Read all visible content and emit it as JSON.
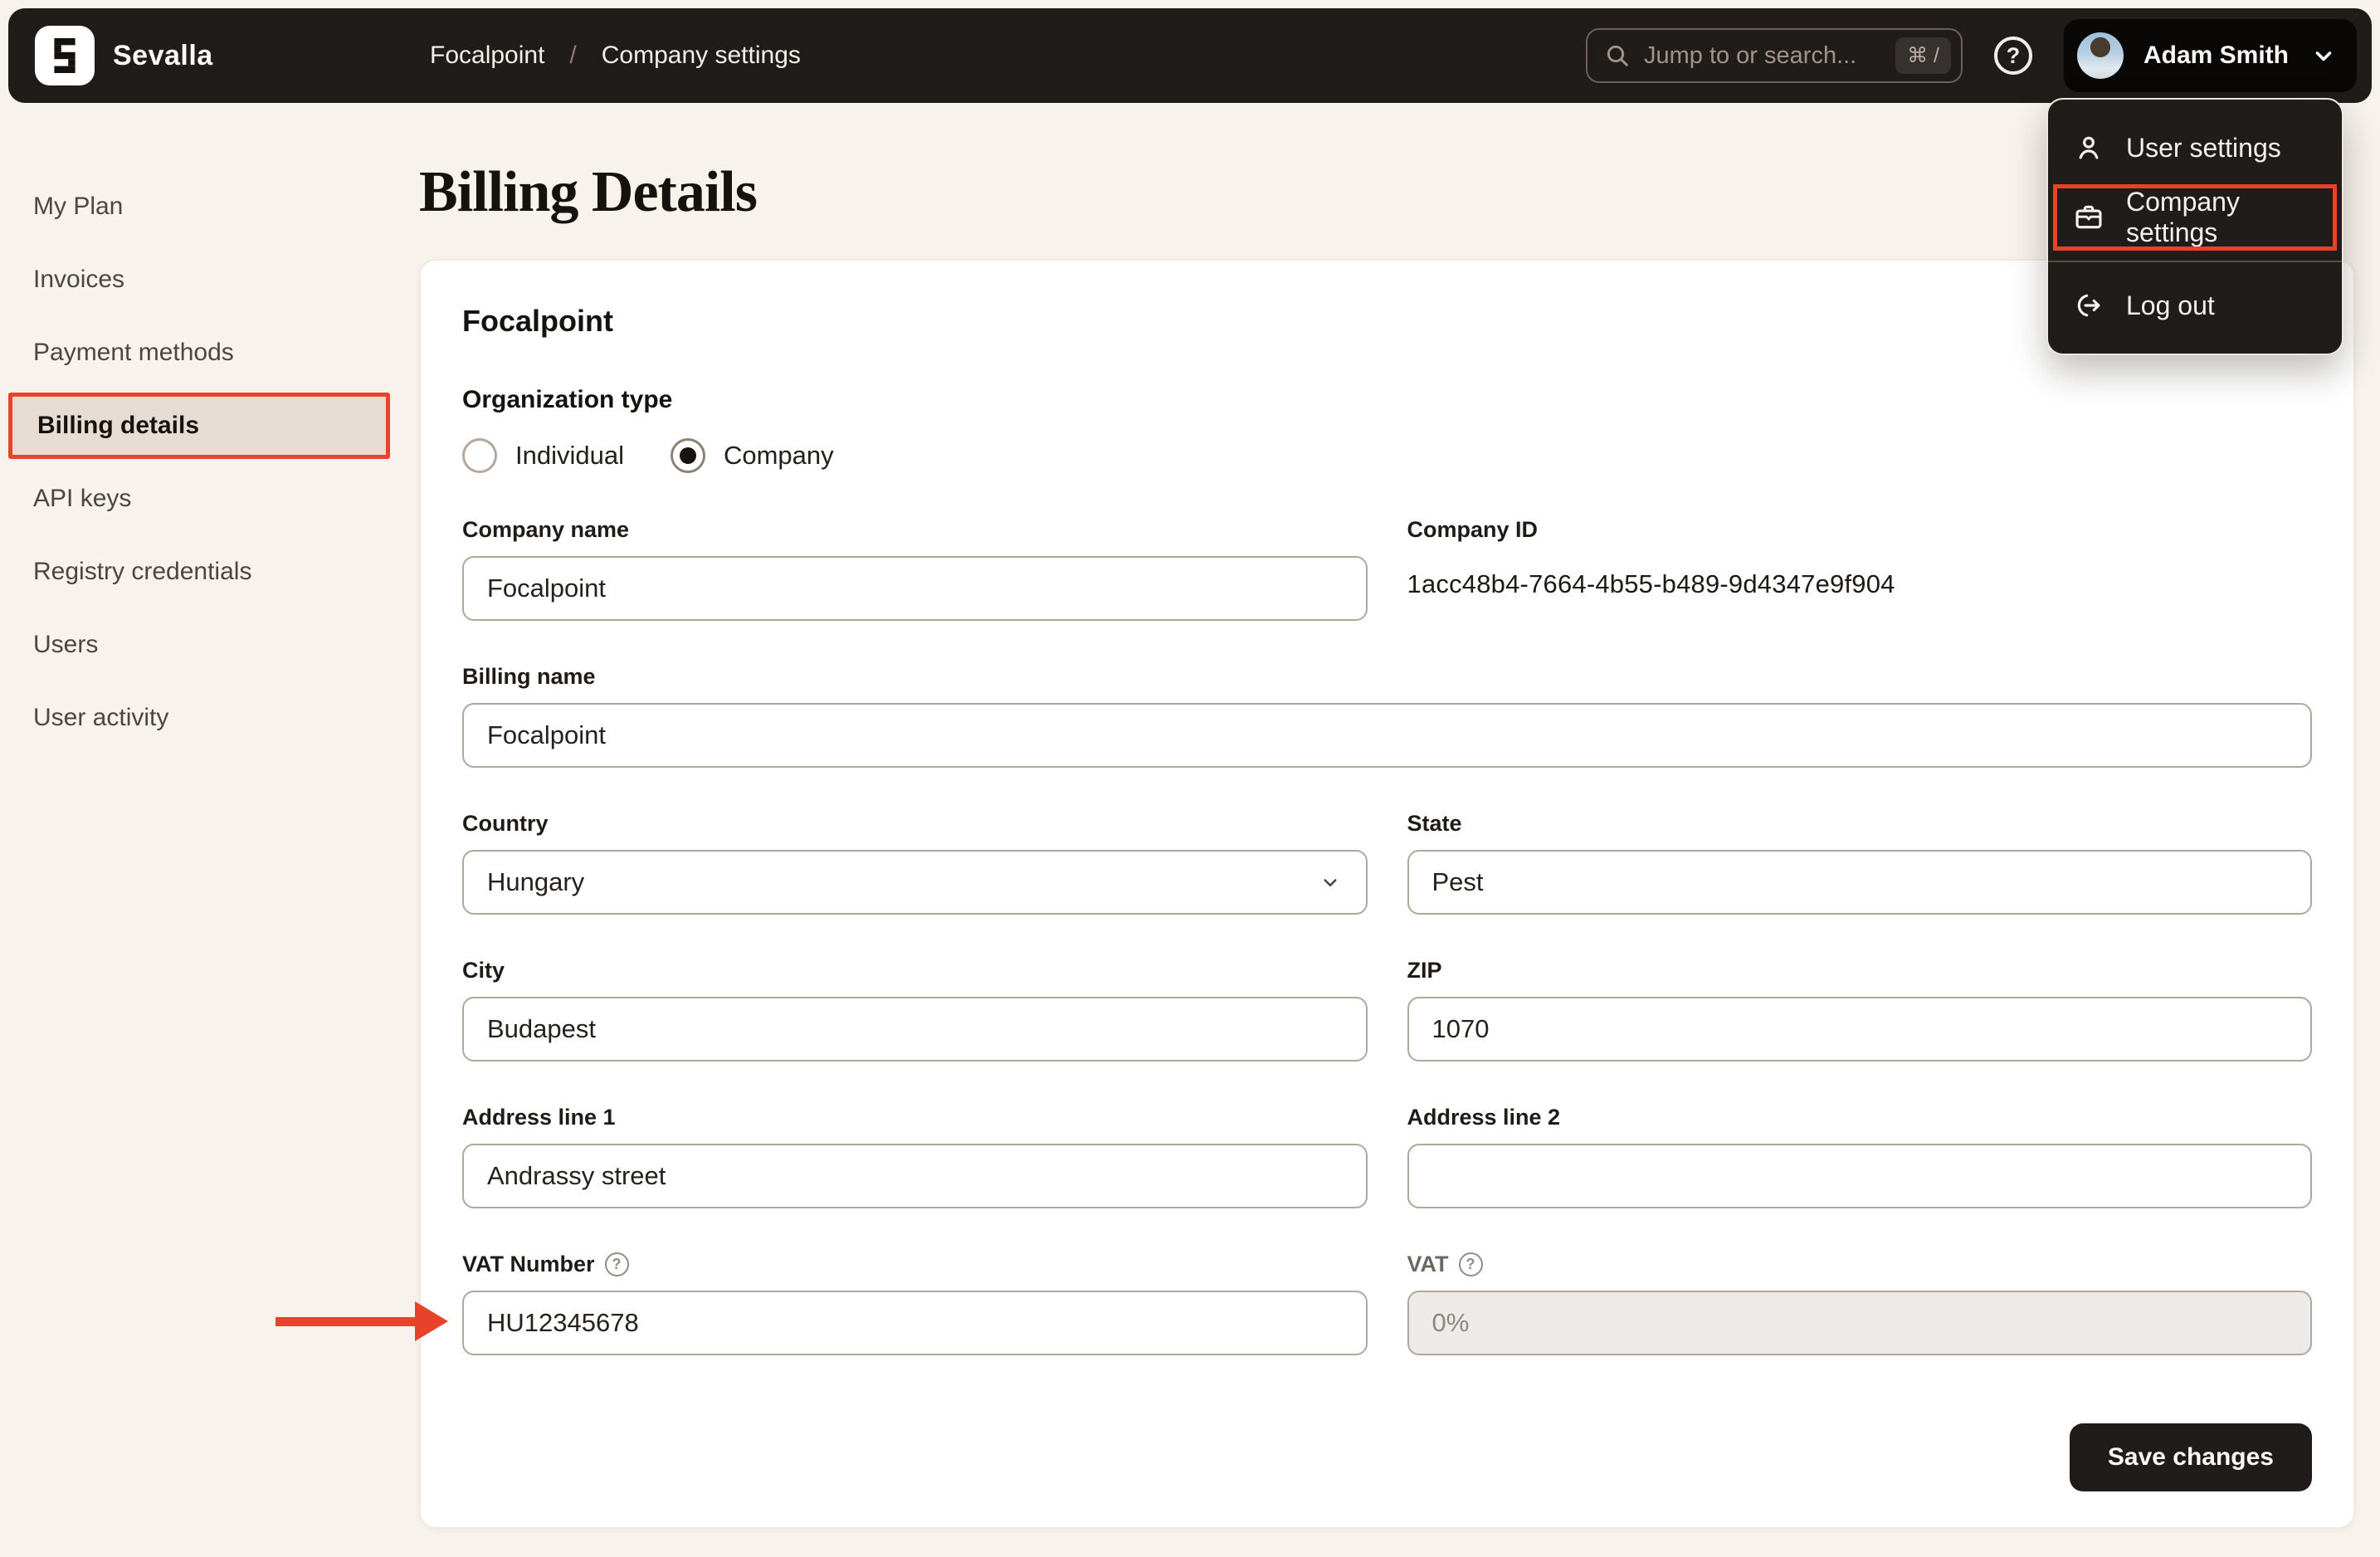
{
  "colors": {
    "accent_red": "#E8432A",
    "topbar_bg": "#201C1A",
    "page_bg": "#F7F2EC",
    "active_sidebar_bg": "#E6DCD3",
    "input_border": "#B3A69B",
    "disabled_input_bg": "#ECEBE9"
  },
  "topbar": {
    "brand": "Sevalla",
    "breadcrumb": [
      "Focalpoint",
      "Company settings"
    ],
    "breadcrumb_separator": "/",
    "search": {
      "placeholder": "Jump to or search...",
      "shortcut": "⌘ /"
    },
    "help_glyph": "?",
    "user": {
      "name": "Adam Smith"
    }
  },
  "user_menu": {
    "items": [
      {
        "label": "User settings",
        "icon": "user-icon",
        "highlighted": false
      },
      {
        "label": "Company settings",
        "icon": "briefcase-icon",
        "highlighted": true
      },
      {
        "label": "Log out",
        "icon": "logout-icon",
        "highlighted": false
      }
    ]
  },
  "sidebar": {
    "items": [
      {
        "label": "My Plan",
        "active": false
      },
      {
        "label": "Invoices",
        "active": false
      },
      {
        "label": "Payment methods",
        "active": false
      },
      {
        "label": "Billing details",
        "active": true
      },
      {
        "label": "API keys",
        "active": false
      },
      {
        "label": "Registry credentials",
        "active": false
      },
      {
        "label": "Users",
        "active": false
      },
      {
        "label": "User activity",
        "active": false
      }
    ]
  },
  "page": {
    "title": "Billing Details"
  },
  "form": {
    "company_title": "Focalpoint",
    "organization_type": {
      "label": "Organization type",
      "options": [
        {
          "label": "Individual",
          "selected": false
        },
        {
          "label": "Company",
          "selected": true
        }
      ]
    },
    "fields": {
      "company_name": {
        "label": "Company name",
        "value": "Focalpoint"
      },
      "company_id": {
        "label": "Company ID",
        "value": "1acc48b4-7664-4b55-b489-9d4347e9f904"
      },
      "billing_name": {
        "label": "Billing name",
        "value": "Focalpoint"
      },
      "country": {
        "label": "Country",
        "value": "Hungary"
      },
      "state": {
        "label": "State",
        "value": "Pest"
      },
      "city": {
        "label": "City",
        "value": "Budapest"
      },
      "zip": {
        "label": "ZIP",
        "value": "1070"
      },
      "address_line_1": {
        "label": "Address line 1",
        "value": "Andrassy street"
      },
      "address_line_2": {
        "label": "Address line 2",
        "value": ""
      },
      "vat_number": {
        "label": "VAT Number",
        "value": "HU12345678",
        "help_glyph": "?"
      },
      "vat": {
        "label": "VAT",
        "value": "0%",
        "help_glyph": "?"
      }
    },
    "save_label": "Save changes"
  }
}
